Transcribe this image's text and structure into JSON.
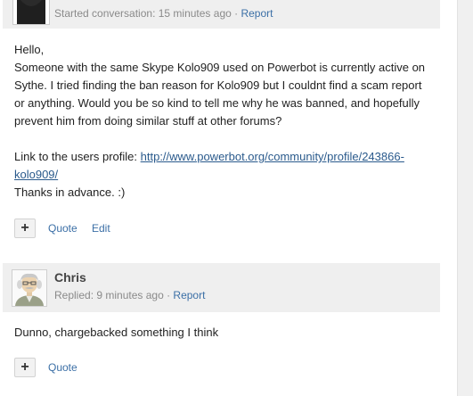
{
  "post1": {
    "meta": "Started conversation: 15 minutes ago",
    "sep": " · ",
    "report": "Report",
    "lines": [
      "Hello,",
      "Someone with the same Skype Kolo909 used on Powerbot is currently active on",
      "Sythe. I tried finding the ban reason for Kolo909 but I couldnt find a scam report",
      "or anything. Would you be so kind to tell me why he was banned, and hopefully",
      "prevent him from doing similar stuff at other forums?"
    ],
    "link_label": "Link to the users profile: ",
    "link_part1": "http://www.powerbot.org/community/profile/243866-",
    "link_part2": "kolo909/",
    "thanks": "Thanks in advance. :)",
    "actions": {
      "plus": "+",
      "quote": "Quote",
      "edit": "Edit"
    }
  },
  "post2": {
    "author": "Chris",
    "meta": "Replied: 9 minutes ago",
    "sep": " · ",
    "report": "Report",
    "text": "Dunno, chargebacked something I think",
    "actions": {
      "plus": "+",
      "quote": "Quote"
    }
  }
}
